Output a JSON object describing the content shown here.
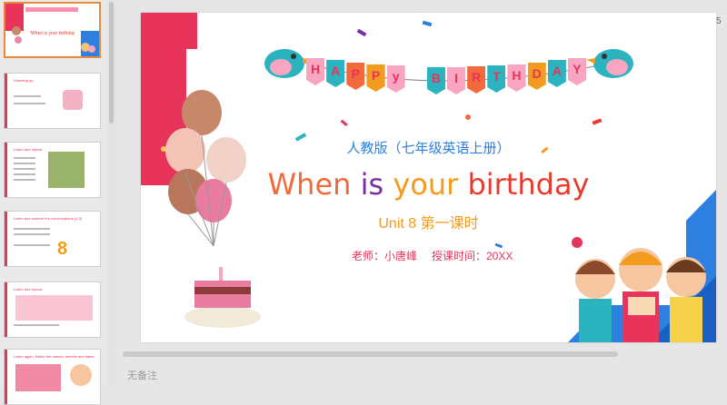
{
  "thumbnails": [
    {
      "title": "When is your birthday",
      "active": true
    },
    {
      "title": "Warming up",
      "active": false
    },
    {
      "title": "Listen and repeat",
      "active": false
    },
    {
      "title": "Listen and number the conversations (1-3)",
      "active": false
    },
    {
      "title": "Listen and repeat",
      "active": false
    },
    {
      "title": "Listen again. Match the names, months and dates.",
      "active": false
    }
  ],
  "slide": {
    "banner_letters": [
      "H",
      "A",
      "P",
      "P",
      "y",
      "",
      "B",
      "I",
      "R",
      "T",
      "H",
      "D",
      "A",
      "Y"
    ],
    "subtitle": "人教版（七年级英语上册）",
    "title_words": [
      {
        "text": "When",
        "color": "#f26a3c"
      },
      {
        "text": "is",
        "color": "#7b2fa0"
      },
      {
        "text": "your",
        "color": "#f39b1e"
      },
      {
        "text": "birthday",
        "color": "#e63b2e"
      }
    ],
    "unit": "Unit 8 第一课时",
    "teacher": "老师：小唐峰",
    "time": "授课时间：20XX"
  },
  "notes_placeholder": "无备注",
  "corner_label": "5",
  "colors": {
    "pink": "#e8335a",
    "blue": "#2d7fe0",
    "teal": "#2bb3c0"
  }
}
